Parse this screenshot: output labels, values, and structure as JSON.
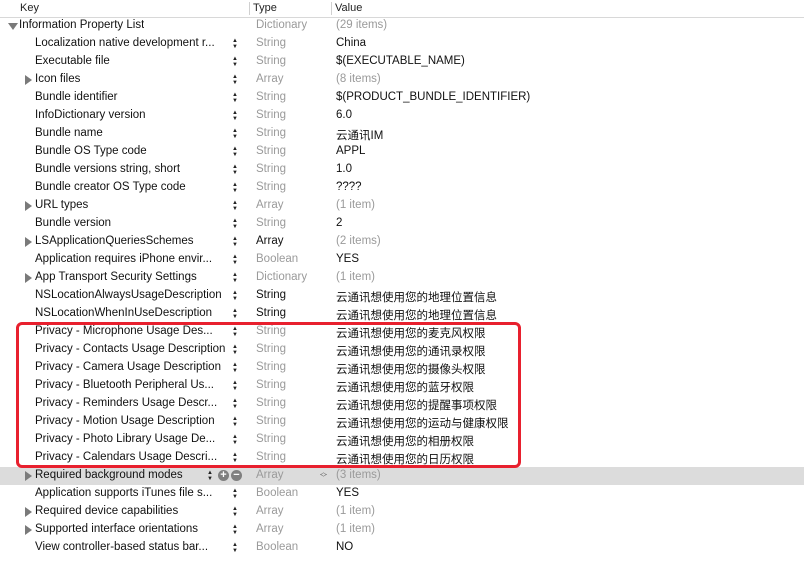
{
  "header": {
    "key": "Key",
    "type": "Type",
    "value": "Value"
  },
  "root": {
    "key": "Information Property List",
    "type": "Dictionary",
    "value": "(29 items)"
  },
  "rows": [
    {
      "key": "Localization native development r...",
      "type": "String",
      "value": "China"
    },
    {
      "key": "Executable file",
      "type": "String",
      "value": "$(EXECUTABLE_NAME)"
    },
    {
      "key": "Icon files",
      "type": "Array",
      "value": "(8 items)"
    },
    {
      "key": "Bundle identifier",
      "type": "String",
      "value": "$(PRODUCT_BUNDLE_IDENTIFIER)"
    },
    {
      "key": "InfoDictionary version",
      "type": "String",
      "value": "6.0"
    },
    {
      "key": "Bundle name",
      "type": "String",
      "value": "云通讯IM"
    },
    {
      "key": "Bundle OS Type code",
      "type": "String",
      "value": "APPL"
    },
    {
      "key": "Bundle versions string, short",
      "type": "String",
      "value": "1.0"
    },
    {
      "key": "Bundle creator OS Type code",
      "type": "String",
      "value": "????"
    },
    {
      "key": "URL types",
      "type": "Array",
      "value": "(1 item)"
    },
    {
      "key": "Bundle version",
      "type": "String",
      "value": "2"
    },
    {
      "key": "LSApplicationQueriesSchemes",
      "type": "Array",
      "value": "(2 items)"
    },
    {
      "key": "Application requires iPhone envir...",
      "type": "Boolean",
      "value": "YES"
    },
    {
      "key": "App Transport Security Settings",
      "type": "Dictionary",
      "value": "(1 item)"
    },
    {
      "key": "NSLocationAlwaysUsageDescription",
      "type": "String",
      "value": "云通讯想使用您的地理位置信息"
    },
    {
      "key": "NSLocationWhenInUseDescription",
      "type": "String",
      "value": "云通讯想使用您的地理位置信息"
    },
    {
      "key": "Privacy - Microphone Usage Des...",
      "type": "String",
      "value": "云通讯想使用您的麦克风权限"
    },
    {
      "key": "Privacy - Contacts Usage Description",
      "type": "String",
      "value": "云通讯想使用您的通讯录权限"
    },
    {
      "key": "Privacy - Camera Usage Description",
      "type": "String",
      "value": "云通讯想使用您的摄像头权限"
    },
    {
      "key": "Privacy - Bluetooth Peripheral Us...",
      "type": "String",
      "value": "云通讯想使用您的蓝牙权限"
    },
    {
      "key": "Privacy - Reminders Usage Descr...",
      "type": "String",
      "value": "云通讯想使用您的提醒事项权限"
    },
    {
      "key": "Privacy - Motion Usage Description",
      "type": "String",
      "value": "云通讯想使用您的运动与健康权限"
    },
    {
      "key": "Privacy - Photo Library Usage De...",
      "type": "String",
      "value": "云通讯想使用您的相册权限"
    },
    {
      "key": "Privacy - Calendars Usage Descri...",
      "type": "String",
      "value": "云通讯想使用您的日历权限"
    },
    {
      "key": "Required background modes",
      "type": "Array",
      "value": "(3 items)"
    },
    {
      "key": "Application supports iTunes file s...",
      "type": "Boolean",
      "value": "YES"
    },
    {
      "key": "Required device capabilities",
      "type": "Array",
      "value": "(1 item)"
    },
    {
      "key": "Supported interface orientations",
      "type": "Array",
      "value": "(1 item)"
    },
    {
      "key": "View controller-based status bar...",
      "type": "Boolean",
      "value": "NO"
    }
  ],
  "colors": {
    "highlight": "#e8202e",
    "selected_row": "#dcdcdc"
  }
}
